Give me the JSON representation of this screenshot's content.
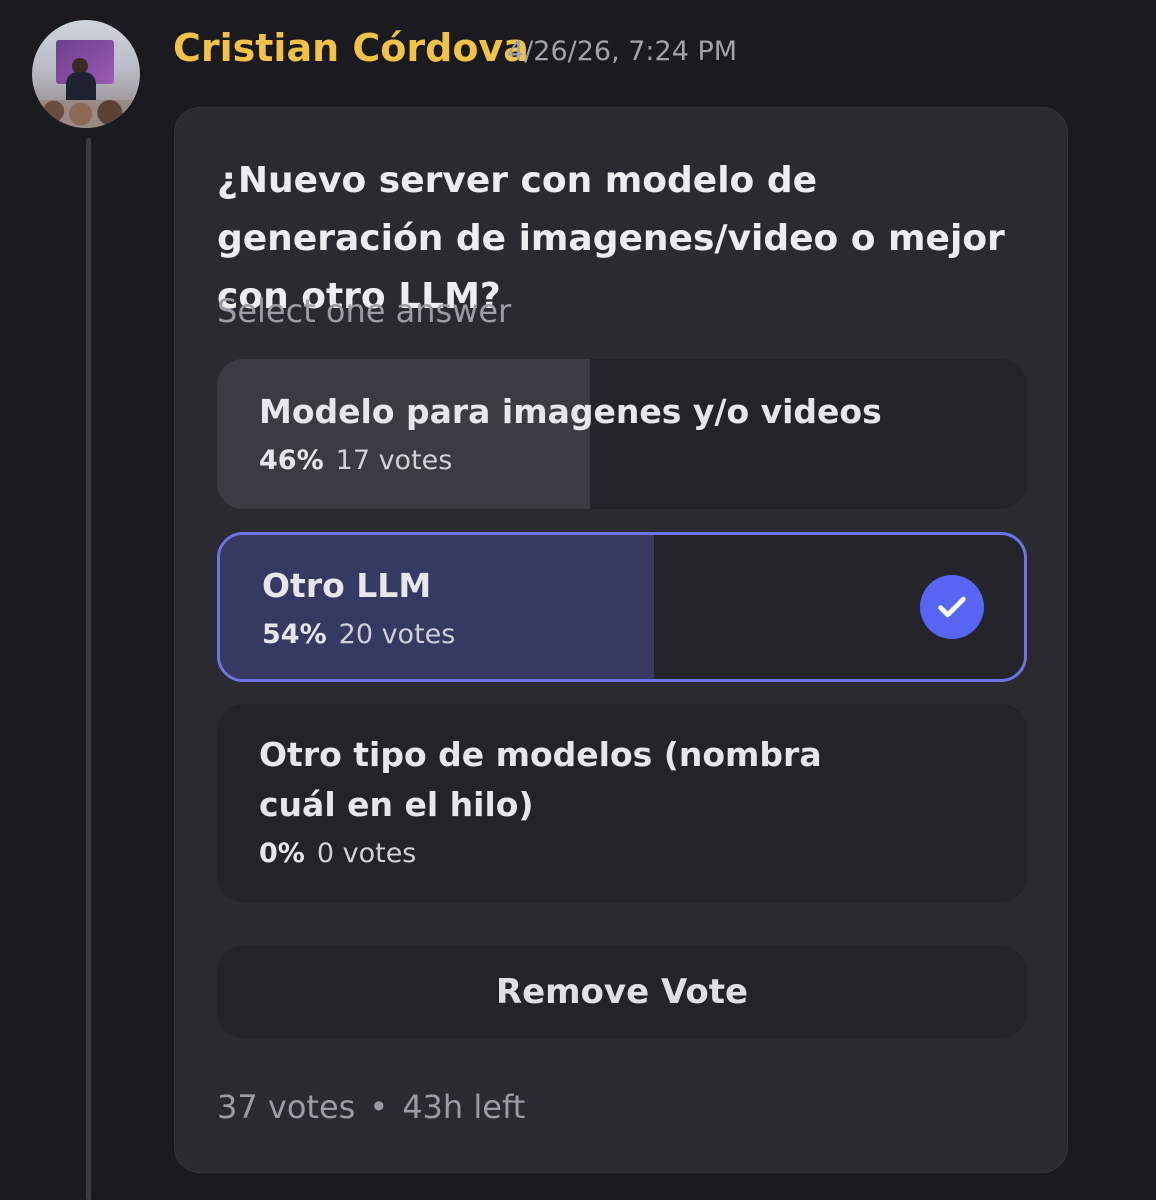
{
  "message": {
    "author": "Cristian Córdova",
    "timestamp": "4/26/26, 7:24 PM",
    "author_color": "#f1c24a"
  },
  "poll": {
    "question": "¿Nuevo server con modelo de generación de imagenes/video o mejor con otro LLM?",
    "subtitle": "Select one answer",
    "options": [
      {
        "label": "Modelo para imagenes y/o videos",
        "percent": "46%",
        "votes": "17 votes",
        "fill_fraction": 0.46,
        "selected": false
      },
      {
        "label": "Otro LLM",
        "percent": "54%",
        "votes": "20 votes",
        "fill_fraction": 0.54,
        "selected": true
      },
      {
        "label": "Otro tipo de modelos (nombra cuál en el hilo)",
        "percent": "0%",
        "votes": "0 votes",
        "fill_fraction": 0.0,
        "selected": false
      }
    ],
    "remove_vote_label": "Remove Vote",
    "total_votes": "37 votes",
    "separator": "•",
    "time_left": "43h left",
    "accent_color": "#5865f2",
    "selected_border_color": "#6f73e6"
  }
}
